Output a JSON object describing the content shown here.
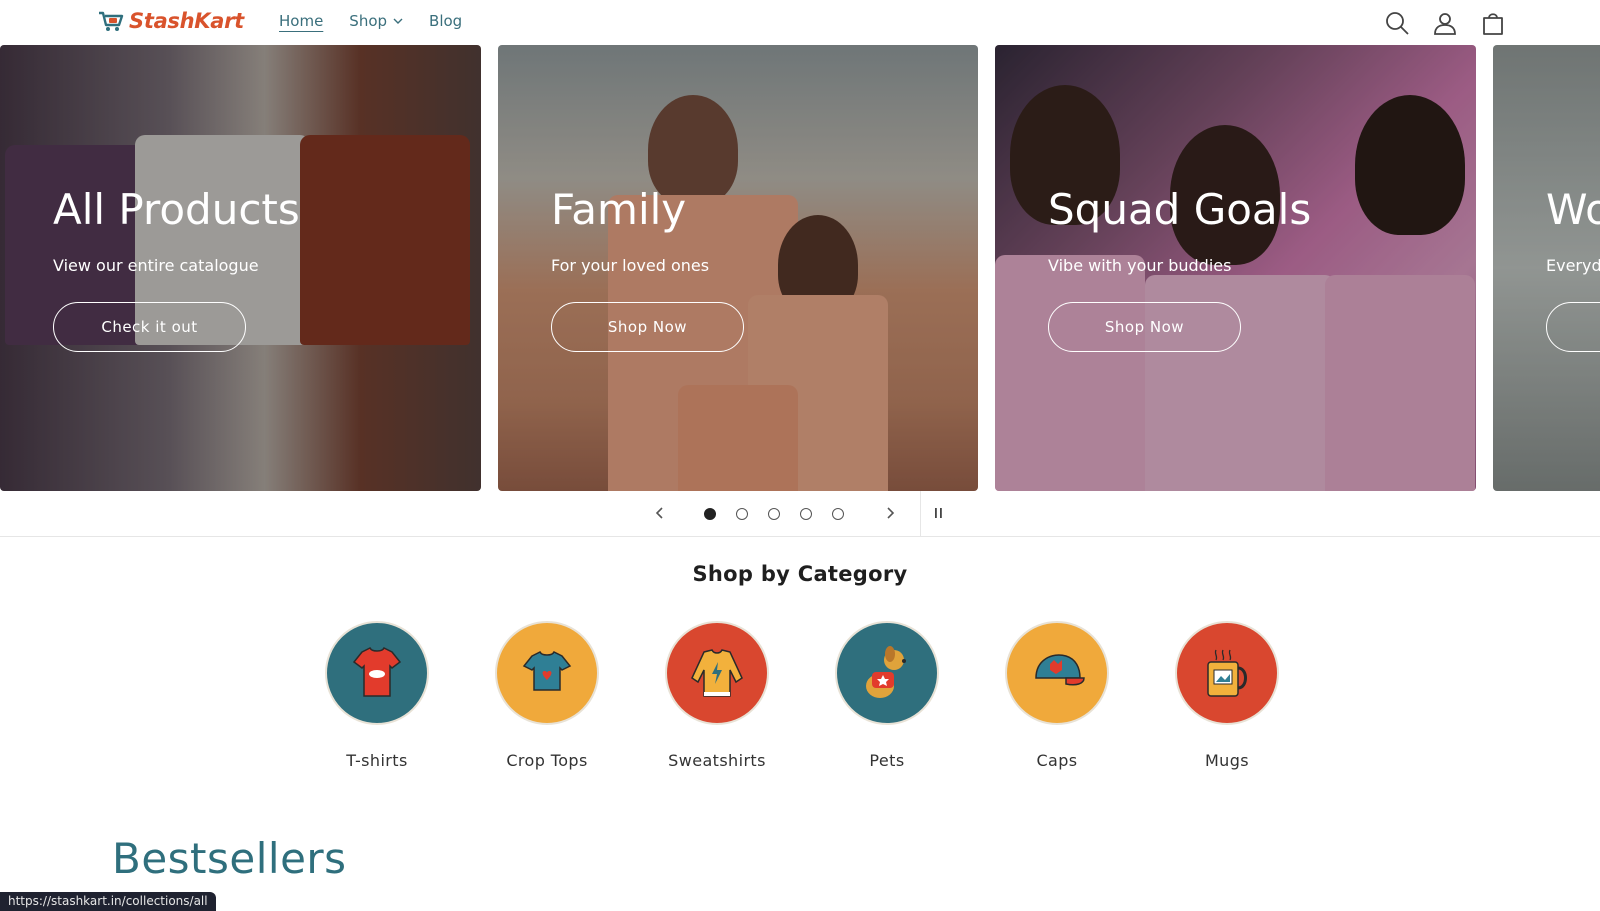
{
  "header": {
    "logo_text": "StashKart",
    "nav": [
      {
        "label": "Home",
        "active": true
      },
      {
        "label": "Shop",
        "has_dropdown": true
      },
      {
        "label": "Blog"
      }
    ],
    "icons": [
      "search-icon",
      "account-icon",
      "cart-icon"
    ]
  },
  "slider": {
    "slides": [
      {
        "title": "All Products",
        "subtitle": "View our entire catalogue",
        "cta": "Check it out"
      },
      {
        "title": "Family",
        "subtitle": "For your loved ones",
        "cta": "Shop Now"
      },
      {
        "title": "Squad Goals",
        "subtitle": "Vibe with your buddies",
        "cta": "Shop Now"
      },
      {
        "title": "Wo",
        "subtitle": "Everyd",
        "cta": ""
      }
    ],
    "dots_total": 5,
    "active_dot": 1
  },
  "categories": {
    "title": "Shop by Category",
    "items": [
      {
        "label": "T-shirts",
        "color": "#2f6f7d",
        "icon": "tshirt-icon"
      },
      {
        "label": "Crop Tops",
        "color": "#f0a93b",
        "icon": "crop-top-icon"
      },
      {
        "label": "Sweatshirts",
        "color": "#d9472f",
        "icon": "sweatshirt-icon"
      },
      {
        "label": "Pets",
        "color": "#2f6f7d",
        "icon": "dog-icon"
      },
      {
        "label": "Caps",
        "color": "#f0a93b",
        "icon": "cap-icon"
      },
      {
        "label": "Mugs",
        "color": "#d9472f",
        "icon": "mug-icon"
      }
    ]
  },
  "section": {
    "bestsellers_title": "Bestsellers"
  },
  "status_bar": {
    "url": "https://stashkart.in/collections/all"
  },
  "colors": {
    "brand": "#d9532c",
    "link": "#3a6f7c",
    "teal": "#2f6f7d",
    "orange": "#f0a93b",
    "red": "#d9472f"
  }
}
